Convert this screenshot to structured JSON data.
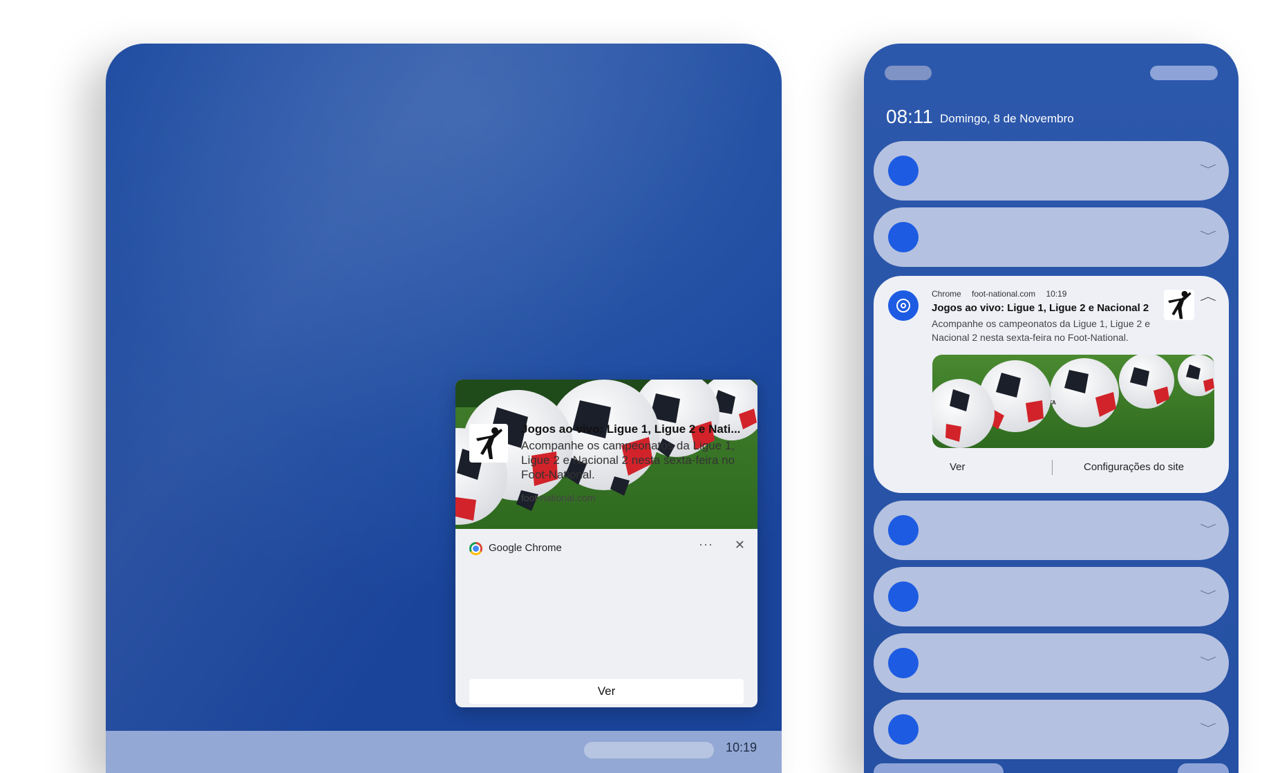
{
  "desktop": {
    "taskbar": {
      "clock": "10:19"
    },
    "toast": {
      "app_name": "Google Chrome",
      "more_label": "···",
      "close_label": "✕",
      "title": "Jogos ao vivo: Ligue 1, Ligue 2 e Nati...",
      "body": "Acompanhe os campeonatos da Ligue 1, Ligue 2 e Nacional 2 nesta sexta-feira no Foot-National.",
      "domain": "foot-national.com",
      "action_label": "Ver"
    }
  },
  "phone": {
    "time": "08:11",
    "date": "Domingo, 8 de Novembro",
    "notification": {
      "app": "Chrome",
      "domain": "foot-national.com",
      "time": "10:19",
      "title": "Jogos ao vivo: Ligue 1, Ligue 2 e Nacional 2",
      "body": "Acompanhe os campeonatos da Ligue 1, Ligue 2 e Nacional 2 nesta sexta-feira no Foot-National.",
      "action_primary": "Ver",
      "action_secondary": "Configurações do site"
    }
  },
  "icons": {
    "chevron_collapsed": "chevron-down-icon",
    "chevron_expanded": "chevron-up-icon",
    "app_logo": "chrome-icon",
    "site_logo": "footballer-silhouette-icon"
  },
  "colors": {
    "wallpaper": "#2a56a8",
    "accent_dot": "#1d5be2",
    "collapsed_card": "#b5c1e0",
    "toast_bg": "#eef0f4"
  }
}
